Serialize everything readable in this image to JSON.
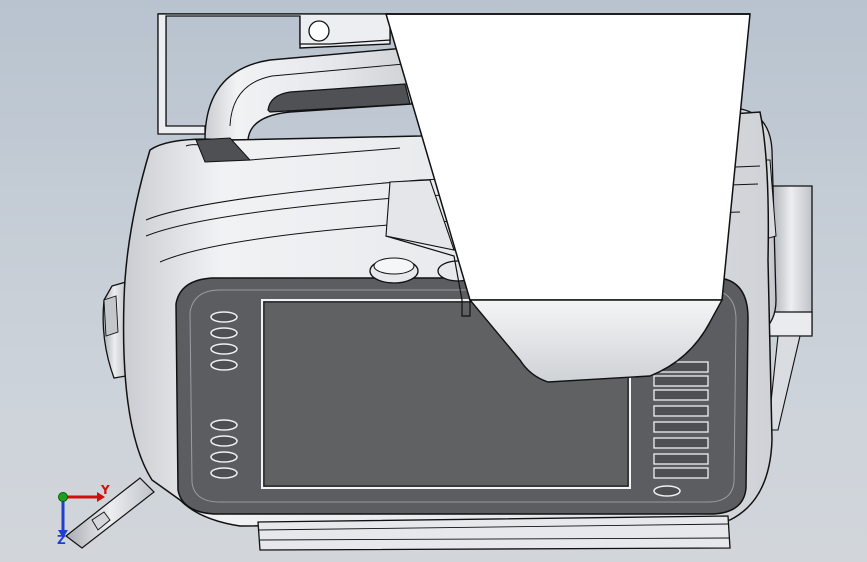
{
  "app": {
    "view": "cad-graphics-area",
    "background_top": "#b8c3cf",
    "background_bottom": "#d2d6db"
  },
  "model": {
    "body_color": "#e3e6ea",
    "face_color": "#5b5d60",
    "edge_color": "#111111",
    "screen_color": "#5f6163"
  },
  "triad": {
    "x_label": "",
    "y_label": "Y",
    "z_label": "Z",
    "colors": {
      "x": "#d01010",
      "y": "#1ea01e",
      "z": "#1f3fd0"
    }
  }
}
